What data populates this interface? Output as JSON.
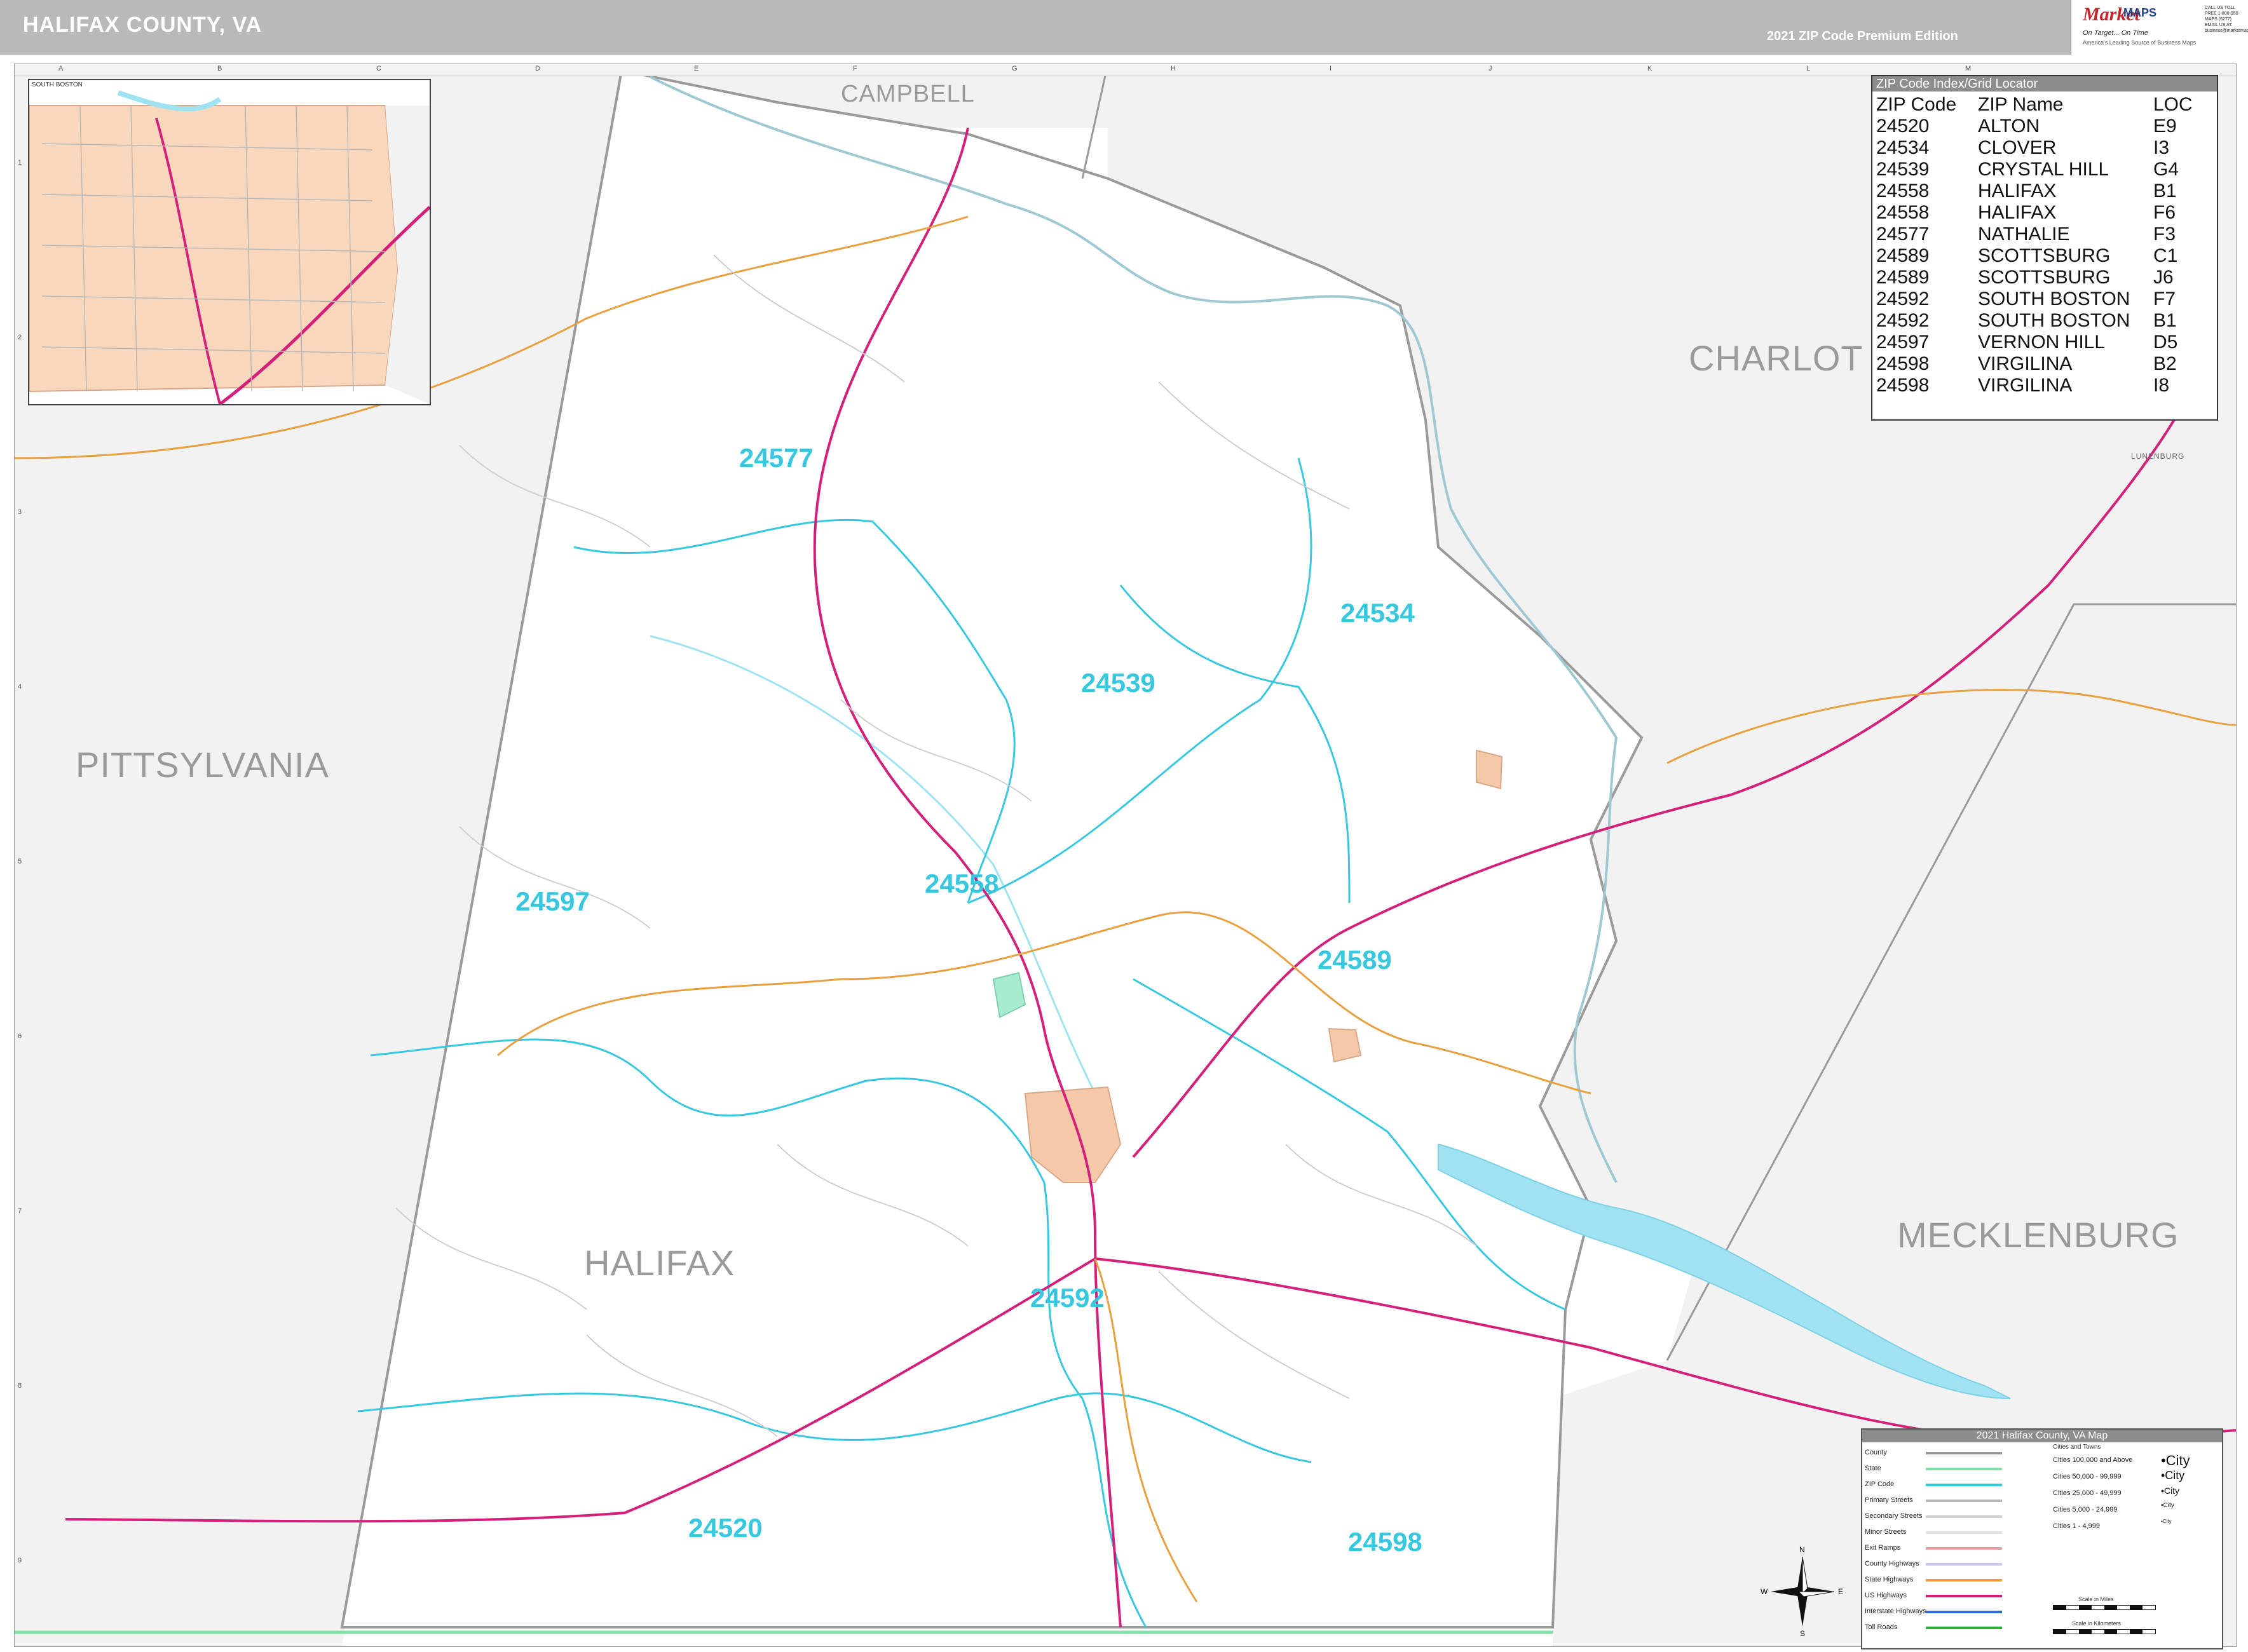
{
  "header": {
    "title": "HALIFAX COUNTY, VA",
    "edition": "2021 ZIP Code Premium Edition",
    "logo_mark": "Market",
    "logo_maps": "MAPS",
    "logo_tagline": "On Target... On Time",
    "logo_tagline2": "America's Leading Source of Business Maps",
    "logo_contact": "CALL US TOLL FREE 1-800-950-MAPS (6277) EMAIL US AT: business@marketmaps.com"
  },
  "grid": {
    "letters": [
      "A",
      "B",
      "C",
      "D",
      "E",
      "F",
      "G",
      "H",
      "I",
      "J",
      "K",
      "L",
      "M"
    ],
    "numbers": [
      "1",
      "2",
      "3",
      "4",
      "5",
      "6",
      "7",
      "8",
      "9"
    ]
  },
  "counties": {
    "campbell": "CAMPBELL",
    "charlotte": "CHARLOT",
    "pittsylvania": "PITTSYLVANIA",
    "halifax": "HALIFAX",
    "mecklenburg": "MECKLENBURG",
    "lunenburg": "LUNENBURG"
  },
  "zips": {
    "z24577": "24577",
    "z24534": "24534",
    "z24539": "24539",
    "z24558": "24558",
    "z24597": "24597",
    "z24589": "24589",
    "z24592": "24592",
    "z24520": "24520",
    "z24598": "24598"
  },
  "inset": {
    "label": "SOUTH BOSTON"
  },
  "zip_index": {
    "title": "ZIP Code Index/Grid Locator",
    "headers": [
      "ZIP Code",
      "ZIP Name",
      "LOC"
    ],
    "rows": [
      [
        "24520",
        "ALTON",
        "E9"
      ],
      [
        "24534",
        "CLOVER",
        "I3"
      ],
      [
        "24539",
        "CRYSTAL HILL",
        "G4"
      ],
      [
        "24558",
        "HALIFAX",
        "B1"
      ],
      [
        "24558",
        "HALIFAX",
        "F6"
      ],
      [
        "24577",
        "NATHALIE",
        "F3"
      ],
      [
        "24589",
        "SCOTTSBURG",
        "C1"
      ],
      [
        "24589",
        "SCOTTSBURG",
        "J6"
      ],
      [
        "24592",
        "SOUTH BOSTON",
        "F7"
      ],
      [
        "24592",
        "SOUTH BOSTON",
        "B1"
      ],
      [
        "24597",
        "VERNON HILL",
        "D5"
      ],
      [
        "24598",
        "VIRGILINA",
        "B2"
      ],
      [
        "24598",
        "VIRGILINA",
        "I8"
      ]
    ]
  },
  "legend": {
    "title": "2021 Halifax County, VA Map",
    "items": [
      {
        "label": "County",
        "color": "#9a9a9a"
      },
      {
        "label": "State",
        "color": "#7fe0a8"
      },
      {
        "label": "ZIP Code",
        "color": "#37c8e0"
      },
      {
        "label": "Primary Streets",
        "color": "#b9b9b9"
      },
      {
        "label": "Secondary Streets",
        "color": "#d0d0d0"
      },
      {
        "label": "Minor Streets",
        "color": "#e3e3e3"
      },
      {
        "label": "Exit Ramps",
        "color": "#e8a0a0"
      },
      {
        "label": "County Highways",
        "color": "#c9c9ee"
      },
      {
        "label": "State Highways",
        "color": "#e8a040"
      },
      {
        "label": "US Highways",
        "color": "#d4207a"
      },
      {
        "label": "Interstate Highways",
        "color": "#2b6fd8"
      },
      {
        "label": "Toll Roads",
        "color": "#2fae3a"
      }
    ],
    "cities_heading": "Cities and Towns",
    "cities": [
      {
        "label": "Cities 100,000 and Above",
        "symbol": "•City"
      },
      {
        "label": "Cities 50,000 - 99,999",
        "symbol": "•City"
      },
      {
        "label": "Cities 25,000 - 49,999",
        "symbol": "•City"
      },
      {
        "label": "Cities 5,000 - 24,999",
        "symbol": "•City"
      },
      {
        "label": "Cities 1 - 4,999",
        "symbol": "•City"
      }
    ],
    "scale_miles": "Scale in Miles",
    "scale_km": "Scale in Kilometers"
  },
  "compass": {
    "n": "N",
    "s": "S",
    "e": "E",
    "w": "W"
  },
  "colors": {
    "water": "#9fe3f2",
    "zip_boundary": "#37c8e0",
    "us_highway": "#d4207a",
    "state_highway": "#e8a040",
    "county_boundary": "#9a9a9a",
    "urban": "#f5c9a8",
    "outside_county": "#f2f2f2"
  }
}
